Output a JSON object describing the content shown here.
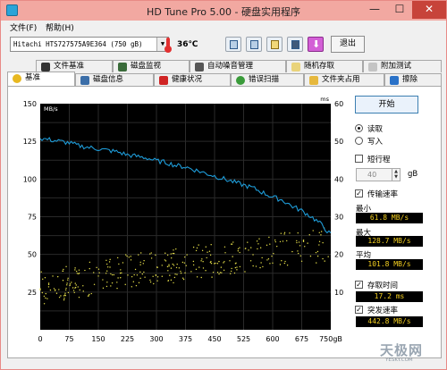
{
  "window": {
    "title": "HD Tune Pro 5.00 - 硬盘实用程序",
    "controls": {
      "minimize": "—",
      "maximize": "☐",
      "close": "✕"
    }
  },
  "menu": {
    "file": "文件(F)",
    "help": "帮助(H)"
  },
  "toolbar": {
    "drive": "Hitachi HTS727575A9E364 (750 gB)",
    "temperature": "36℃",
    "exit_label": "退出",
    "icons": [
      "copy-info-icon",
      "copy-icon",
      "email-icon",
      "screenshot-icon",
      "download-icon"
    ]
  },
  "tabs_top": [
    {
      "label": "文件基准",
      "icon": "file-icon"
    },
    {
      "label": "磁盘监视",
      "icon": "monitor-icon"
    },
    {
      "label": "自动噪音管理",
      "icon": "speaker-icon"
    },
    {
      "label": "随机存取",
      "icon": "random-access-icon"
    },
    {
      "label": "附加测试",
      "icon": "extra-tests-icon"
    }
  ],
  "tabs_bottom": [
    {
      "label": "基准",
      "icon": "benchmark-icon",
      "active": true
    },
    {
      "label": "磁盘信息",
      "icon": "disk-info-icon"
    },
    {
      "label": "健康状况",
      "icon": "health-icon"
    },
    {
      "label": "错误扫描",
      "icon": "error-scan-icon"
    },
    {
      "label": "文件夹占用",
      "icon": "folder-icon"
    },
    {
      "label": "擦除",
      "icon": "erase-icon"
    }
  ],
  "controls": {
    "start_label": "开始",
    "read_label": "读取",
    "write_label": "写入",
    "short_stroke_label": "短行程",
    "short_stroke_value": "40",
    "short_stroke_unit": "gB",
    "transfer_rate_label": "传输速率",
    "min_label": "最小",
    "min_value": "61.8 MB/s",
    "max_label": "最大",
    "max_value": "128.7 MB/s",
    "avg_label": "平均",
    "avg_value": "101.8 MB/s",
    "access_time_label": "存取时间",
    "access_time_value": "17.2 ms",
    "burst_rate_label": "突发速率",
    "burst_rate_value": "442.8 MB/s"
  },
  "watermark": {
    "text": "天极网",
    "sub": "YESKY.COM"
  },
  "chart_data": {
    "type": "line",
    "xlabel": "gB",
    "y_left_unit": "MB/s",
    "y_right_unit": "ms",
    "x_ticks": [
      "0",
      "75",
      "150",
      "225",
      "300",
      "375",
      "450",
      "525",
      "600",
      "675",
      "750gB"
    ],
    "y_left_ticks": [
      "25",
      "50",
      "75",
      "100",
      "125",
      "150"
    ],
    "y_right_ticks": [
      "10",
      "20",
      "30",
      "40",
      "50",
      "60"
    ],
    "xlim": [
      0,
      750
    ],
    "ylim_left": [
      0,
      150
    ],
    "ylim_right": [
      0,
      60
    ],
    "colors": {
      "background": "#000000",
      "grid": "#2a2a2a",
      "transfer": "#1e9bd7",
      "access": "#e8e14a"
    },
    "series": [
      {
        "name": "传输速率",
        "axis": "left",
        "x": [
          0,
          25,
          50,
          75,
          100,
          125,
          150,
          175,
          200,
          225,
          250,
          275,
          300,
          325,
          350,
          375,
          400,
          425,
          450,
          475,
          500,
          525,
          550,
          575,
          600,
          625,
          650,
          675,
          700,
          725,
          750
        ],
        "values": [
          127,
          126,
          125,
          124,
          122,
          121,
          120,
          119,
          118,
          116,
          115,
          114,
          112,
          111,
          109,
          108,
          106,
          104,
          102,
          100,
          98,
          96,
          94,
          91,
          88,
          86,
          82,
          79,
          75,
          70,
          63
        ]
      },
      {
        "name": "存取时间",
        "axis": "right",
        "style": "scatter",
        "x": [
          0,
          50,
          100,
          150,
          200,
          250,
          300,
          350,
          400,
          450,
          500,
          550,
          600,
          650,
          700,
          750
        ],
        "values": [
          11,
          12,
          13,
          14,
          15,
          16,
          16.5,
          17,
          18,
          18.5,
          19.5,
          20,
          21,
          21.5,
          22,
          23
        ]
      }
    ]
  }
}
